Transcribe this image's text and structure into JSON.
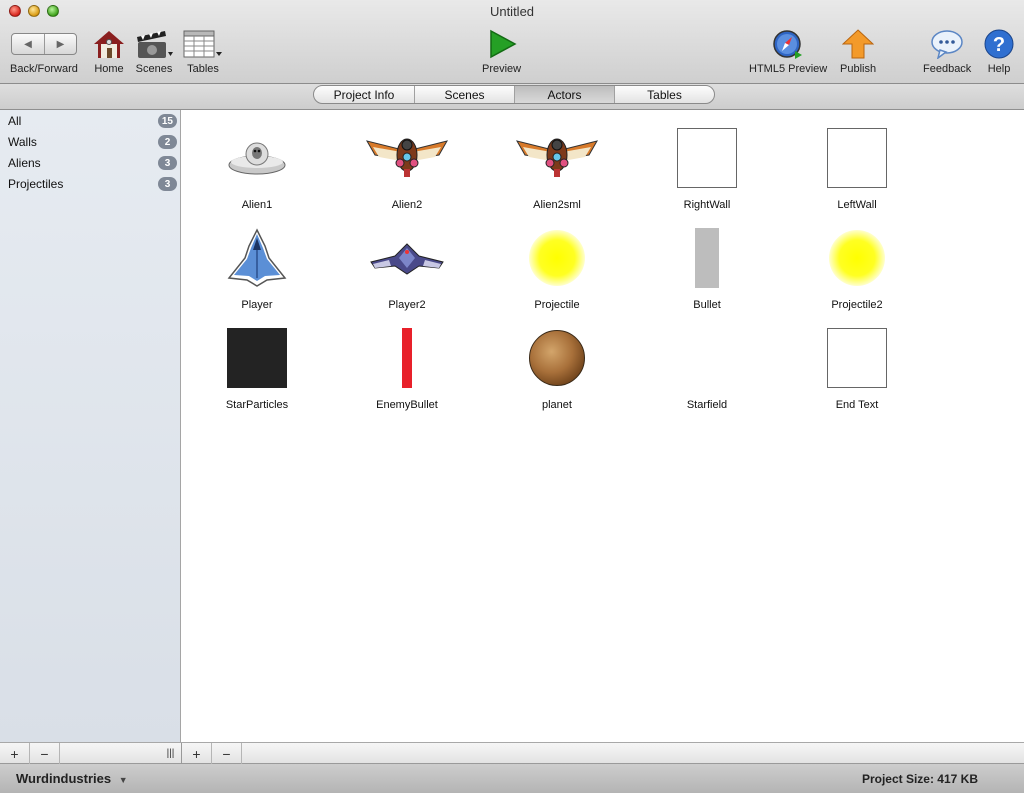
{
  "window": {
    "title": "Untitled"
  },
  "toolbar": {
    "back_forward": "Back/Forward",
    "home": "Home",
    "scenes": "Scenes",
    "tables": "Tables",
    "preview": "Preview",
    "html5_preview": "HTML5 Preview",
    "publish": "Publish",
    "feedback": "Feedback",
    "help": "Help"
  },
  "tabs": [
    "Project Info",
    "Scenes",
    "Actors",
    "Tables"
  ],
  "active_tab": "Actors",
  "sidebar": {
    "items": [
      {
        "label": "All",
        "count": "15"
      },
      {
        "label": "Walls",
        "count": "2"
      },
      {
        "label": "Aliens",
        "count": "3"
      },
      {
        "label": "Projectiles",
        "count": "3"
      }
    ]
  },
  "actors": [
    {
      "name": "Alien1",
      "icon": "ufo-icon"
    },
    {
      "name": "Alien2",
      "icon": "winged-alien-icon"
    },
    {
      "name": "Alien2sml",
      "icon": "winged-alien-icon"
    },
    {
      "name": "RightWall",
      "icon": "white-box-icon"
    },
    {
      "name": "LeftWall",
      "icon": "white-box-icon"
    },
    {
      "name": "Player",
      "icon": "spaceship-icon"
    },
    {
      "name": "Player2",
      "icon": "spaceship-wide-icon"
    },
    {
      "name": "Projectile",
      "icon": "yellow-glow-icon"
    },
    {
      "name": "Bullet",
      "icon": "gray-bar-icon"
    },
    {
      "name": "Projectile2",
      "icon": "yellow-glow-icon"
    },
    {
      "name": "StarParticles",
      "icon": "black-square-icon"
    },
    {
      "name": "EnemyBullet",
      "icon": "red-bar-icon"
    },
    {
      "name": "planet",
      "icon": "planet-icon"
    },
    {
      "name": "Starfield",
      "icon": "empty-icon"
    },
    {
      "name": "End Text",
      "icon": "white-box-icon"
    }
  ],
  "bottom": {
    "add": "+",
    "remove": "−",
    "grip": "|||"
  },
  "status": {
    "account": "Wurdindustries",
    "project_size": "Project Size: 417 KB"
  }
}
